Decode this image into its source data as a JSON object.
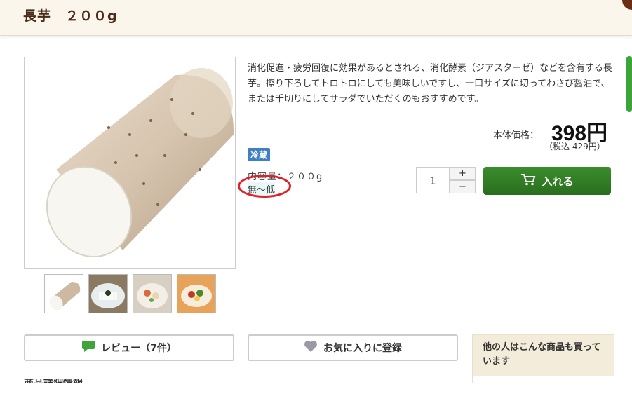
{
  "product": {
    "title": "長芋　２００g",
    "description": "消化促進・疲労回復に効果があるとされる、消化酵素（ジアスターゼ）などを含有する長芋。擦り下ろしてトロトロにしても美味しいですし、一口サイズに切ってわさび醤油で、または千切りにしてサラダでいただくのもおすすめです。",
    "price_label": "本体価格：",
    "price": "398円",
    "price_with_tax": "（税込 429円）",
    "storage_badge": "冷蔵",
    "content_amount": "内容量：２００g",
    "allergy_level": "無～低"
  },
  "quantity": {
    "value": "1",
    "plus": "+",
    "minus": "−"
  },
  "cart_button": {
    "label": "入れる"
  },
  "actions": {
    "review_label": "レビュー（7件）",
    "favorite_label": "お気に入りに登録"
  },
  "sidebar": {
    "heading": "他の人はこんな商品も買っています"
  },
  "section": {
    "details_heading": "商品詳細情報"
  },
  "colors": {
    "accent_green": "#2f7d24",
    "badge_blue": "#3f7fc3",
    "annotation_red": "#e0202a",
    "title_brown": "#4b2b18"
  },
  "icons": {
    "cart": "cart-icon",
    "review": "speech-bubble-icon",
    "favorite": "heart-icon"
  }
}
